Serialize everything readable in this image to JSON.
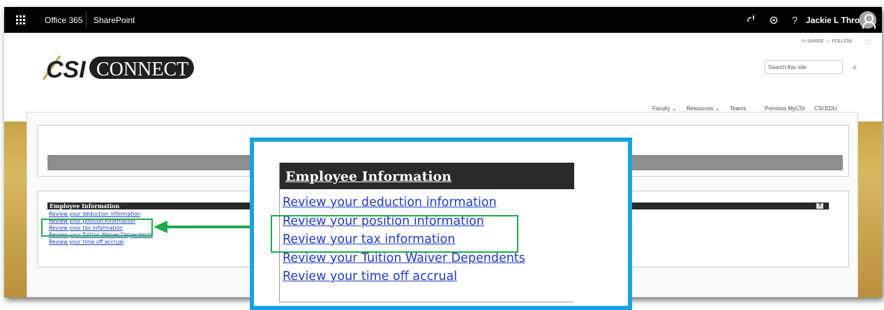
{
  "suite_bar": {
    "office_label": "Office 365",
    "app_label": "SharePoint",
    "user_name": "Jackie L Throng..."
  },
  "page_actions": {
    "share_label": "SHARE",
    "follow_label": "FOLLOW"
  },
  "logo": {
    "part1": "CSI",
    "part2": "CONNECT"
  },
  "search": {
    "placeholder": "Search this site"
  },
  "nav": {
    "items": [
      {
        "label": "Faculty",
        "has_dropdown": true
      },
      {
        "label": "Resources",
        "has_dropdown": true
      },
      {
        "label": "Teams",
        "has_dropdown": false
      },
      {
        "label": "Previous MyCSI",
        "has_dropdown": false
      },
      {
        "label": "CSI.EDU",
        "has_dropdown": false
      }
    ]
  },
  "employee_panel": {
    "title": "Employee Information",
    "help": "?",
    "links": [
      "Review your deduction information",
      "Review your position information",
      "Review your tax information",
      "Review your Tuition Waiver Dependents",
      "Review your time off accrual"
    ]
  },
  "callout": {
    "title": "Employee Information",
    "links": [
      "Review your deduction information",
      "Review your position information",
      "Review your tax information",
      "Review your Tuition Waiver Dependents",
      "Review your time off accrual"
    ],
    "zoom_border_color": "#1aa1e0",
    "highlight_color": "#21a84a"
  }
}
